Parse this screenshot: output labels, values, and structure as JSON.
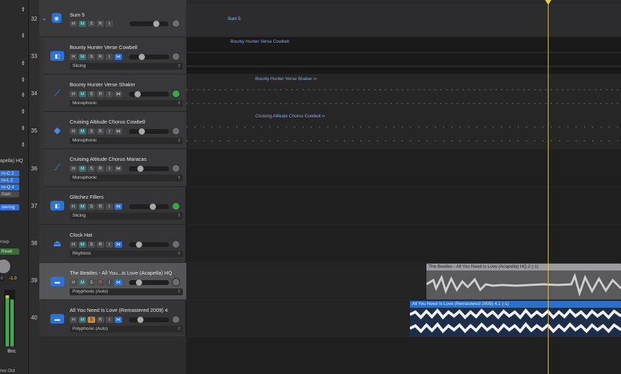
{
  "inspector": {
    "region_name": "apella) HQ",
    "plugins": [
      "ro-C 2",
      "ro-L 2",
      "ro-Q 4"
    ],
    "gain_label": "Gain",
    "mastering_label": "stering",
    "group_label": "roup",
    "automation_mode": "Read",
    "volume_left": "0",
    "volume_right": "-1.0",
    "bounce_label": "Bnc",
    "output_label": "reo Out"
  },
  "tracks": [
    {
      "number": "32",
      "name": "Sum 5",
      "mode": "",
      "type": "folder"
    },
    {
      "number": "33",
      "name": "Bounty Hunter Verse Cowbell",
      "mode": "Slicing"
    },
    {
      "number": "34",
      "name": "Bounty Hunter Verse Shaker",
      "mode": "Monophonic"
    },
    {
      "number": "35",
      "name": "Cruising Altitude Chorus Cowbell",
      "mode": "Monophonic"
    },
    {
      "number": "36",
      "name": "Cruising Altitude Chorus Maracas",
      "mode": "Monophonic"
    },
    {
      "number": "37",
      "name": "Glitchez Fillers",
      "mode": "Slicing"
    },
    {
      "number": "38",
      "name": "Clock Hat",
      "mode": "Rhythmic"
    },
    {
      "number": "39",
      "name": "The Beatles - All You...is Love (Acapella) HQ",
      "mode": "Polyphonic (Auto)"
    },
    {
      "number": "40",
      "name": "All You Need Is Love (Remastered 2009) 4",
      "mode": "Polyphonic (Auto)"
    }
  ],
  "buttons": {
    "h": "H",
    "m": "M",
    "s": "S",
    "r": "R",
    "i": "I"
  },
  "regions": {
    "sum5": "Sum 5",
    "bh_cowbell": "Bounty Hunter Verse Cowbell",
    "bh_shaker": "Bounty Hunter Verse Shaker",
    "ca_cowbell": "Cruising Altitude Chorus Cowbell",
    "beatles": "The Beatles - All You Need is Love (Acapella) HQ.2 (-1)",
    "remastered": "All You Need Is Love (Remastered 2009) 4.1 (-1)"
  },
  "icons": {
    "folder": "folder-track-icon",
    "drum": "drum-machine-icon",
    "stick": "drumstick-icon",
    "tag": "tag-icon",
    "hat": "hi-hat-icon",
    "wave": "waveform-icon",
    "link": "flex-link-icon",
    "loop": "loop-icon"
  },
  "colors": {
    "accent": "#2c73d9",
    "solo": "#d08a2a",
    "playhead": "#e8cf4e",
    "region_blue": "#86aeea",
    "region_selected": "#2a6fc9"
  }
}
